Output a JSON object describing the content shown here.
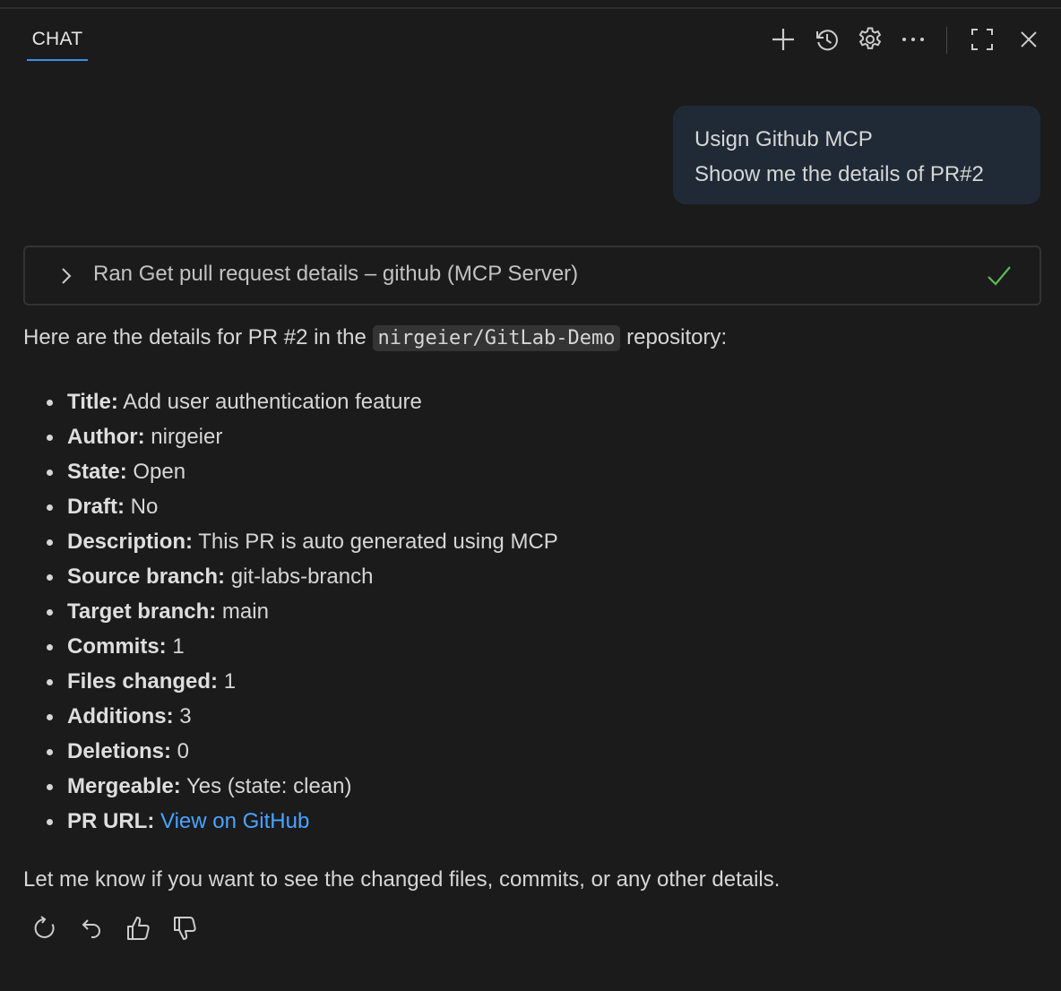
{
  "header": {
    "tab_label": "CHAT",
    "toolbar_icons": [
      "plus-icon",
      "history-icon",
      "gear-icon",
      "more-icon",
      "maximize-icon",
      "close-icon"
    ]
  },
  "user_message": {
    "line1": "Usign Github MCP",
    "line2": "Shoow me the details of PR#2"
  },
  "tool_call": {
    "label": "Ran Get pull request details – github (MCP Server)",
    "status": "success"
  },
  "response": {
    "intro_before": "Here are the details for PR #2 in the ",
    "repo": "nirgeier/GitLab-Demo",
    "intro_after": " repository:",
    "details": [
      {
        "key": "Title:",
        "value": " Add user authentication feature"
      },
      {
        "key": "Author:",
        "value": " nirgeier"
      },
      {
        "key": "State:",
        "value": " Open"
      },
      {
        "key": "Draft:",
        "value": " No"
      },
      {
        "key": "Description:",
        "value": " This PR is auto generated using MCP"
      },
      {
        "key": "Source branch:",
        "value": " git-labs-branch"
      },
      {
        "key": "Target branch:",
        "value": " main"
      },
      {
        "key": "Commits:",
        "value": " 1"
      },
      {
        "key": "Files changed:",
        "value": " 1"
      },
      {
        "key": "Additions:",
        "value": " 3"
      },
      {
        "key": "Deletions:",
        "value": " 0"
      },
      {
        "key": "Mergeable:",
        "value": " Yes (state: clean)"
      }
    ],
    "pr_url_key": "PR URL:",
    "pr_url_link": "View on GitHub",
    "outro": "Let me know if you want to see the changed files, commits, or any other details."
  },
  "colors": {
    "background": "#1b1b1c",
    "accent": "#3b8eea",
    "link": "#4aa3ff",
    "success": "#5fb85a",
    "user_bubble": "#1f2a36"
  }
}
